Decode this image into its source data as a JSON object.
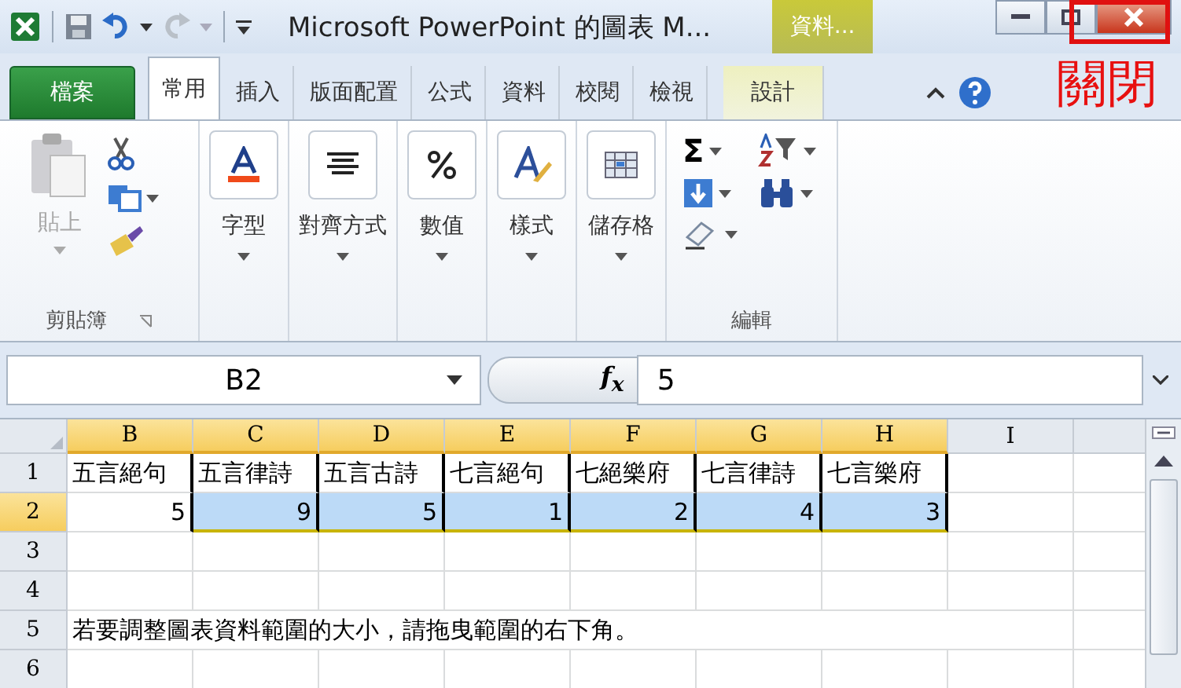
{
  "window": {
    "title": "Microsoft PowerPoint 的圖表 M...",
    "context_group": "資料..."
  },
  "tabs": [
    {
      "label": "檔案",
      "kind": "file",
      "selected": false
    },
    {
      "label": "常用",
      "kind": "tab",
      "selected": true
    },
    {
      "label": "插入",
      "kind": "tab",
      "selected": false
    },
    {
      "label": "版面配置",
      "kind": "tab",
      "selected": false
    },
    {
      "label": "公式",
      "kind": "tab",
      "selected": false
    },
    {
      "label": "資料",
      "kind": "tab",
      "selected": false
    },
    {
      "label": "校閱",
      "kind": "tab",
      "selected": false
    },
    {
      "label": "檢視",
      "kind": "tab",
      "selected": false
    },
    {
      "label": "設計",
      "kind": "context",
      "selected": false
    }
  ],
  "ribbon": {
    "clipboard": {
      "paste": {
        "label": "貼上",
        "disabled": true
      },
      "group_label": "剪貼簿"
    },
    "buttons": [
      {
        "label": "字型",
        "kind": "font"
      },
      {
        "label": "對齊方式",
        "kind": "align"
      },
      {
        "label": "數值",
        "kind": "number"
      },
      {
        "label": "樣式",
        "kind": "style"
      },
      {
        "label": "儲存格",
        "kind": "cells"
      }
    ],
    "editing": {
      "autosum": "Σ",
      "group_label": "編輯"
    }
  },
  "formula_bar": {
    "name_box": "B2",
    "fx": "f$_{x}$",
    "value": "5"
  },
  "sheet": {
    "columns": [
      {
        "label": "B",
        "selected": true
      },
      {
        "label": "C",
        "selected": true
      },
      {
        "label": "D",
        "selected": true
      },
      {
        "label": "E",
        "selected": true
      },
      {
        "label": "F",
        "selected": true
      },
      {
        "label": "G",
        "selected": true
      },
      {
        "label": "H",
        "selected": true
      },
      {
        "label": "I",
        "selected": false
      }
    ],
    "rows": [
      {
        "label": "1",
        "selected": false,
        "cells": [
          {
            "text": "五言絕句",
            "kind": "text",
            "selected": false
          },
          {
            "text": "五言律詩",
            "kind": "text",
            "selected": false
          },
          {
            "text": "五言古詩",
            "kind": "text",
            "selected": false
          },
          {
            "text": "七言絕句",
            "kind": "text",
            "selected": false
          },
          {
            "text": "七絕樂府",
            "kind": "text",
            "selected": false
          },
          {
            "text": "七言律詩",
            "kind": "text",
            "selected": false
          },
          {
            "text": "七言樂府",
            "kind": "text",
            "selected": false
          }
        ]
      },
      {
        "label": "2",
        "selected": true,
        "cells": [
          {
            "text": "5",
            "kind": "number",
            "selected": false
          },
          {
            "text": "9",
            "kind": "number",
            "selected": true
          },
          {
            "text": "5",
            "kind": "number",
            "selected": true
          },
          {
            "text": "1",
            "kind": "number",
            "selected": true
          },
          {
            "text": "2",
            "kind": "number",
            "selected": true
          },
          {
            "text": "4",
            "kind": "number",
            "selected": true
          },
          {
            "text": "3",
            "kind": "number",
            "selected": true
          }
        ]
      },
      {
        "label": "3",
        "selected": false,
        "cells": []
      },
      {
        "label": "4",
        "selected": false,
        "cells": []
      },
      {
        "label": "5",
        "selected": false,
        "cells": [
          {
            "text": "若要調整圖表資料範圍的大小，請拖曳範圍的右下角。",
            "kind": "note"
          }
        ]
      },
      {
        "label": "6",
        "selected": false,
        "cells": []
      }
    ]
  },
  "annotation": {
    "text": "關閉"
  }
}
